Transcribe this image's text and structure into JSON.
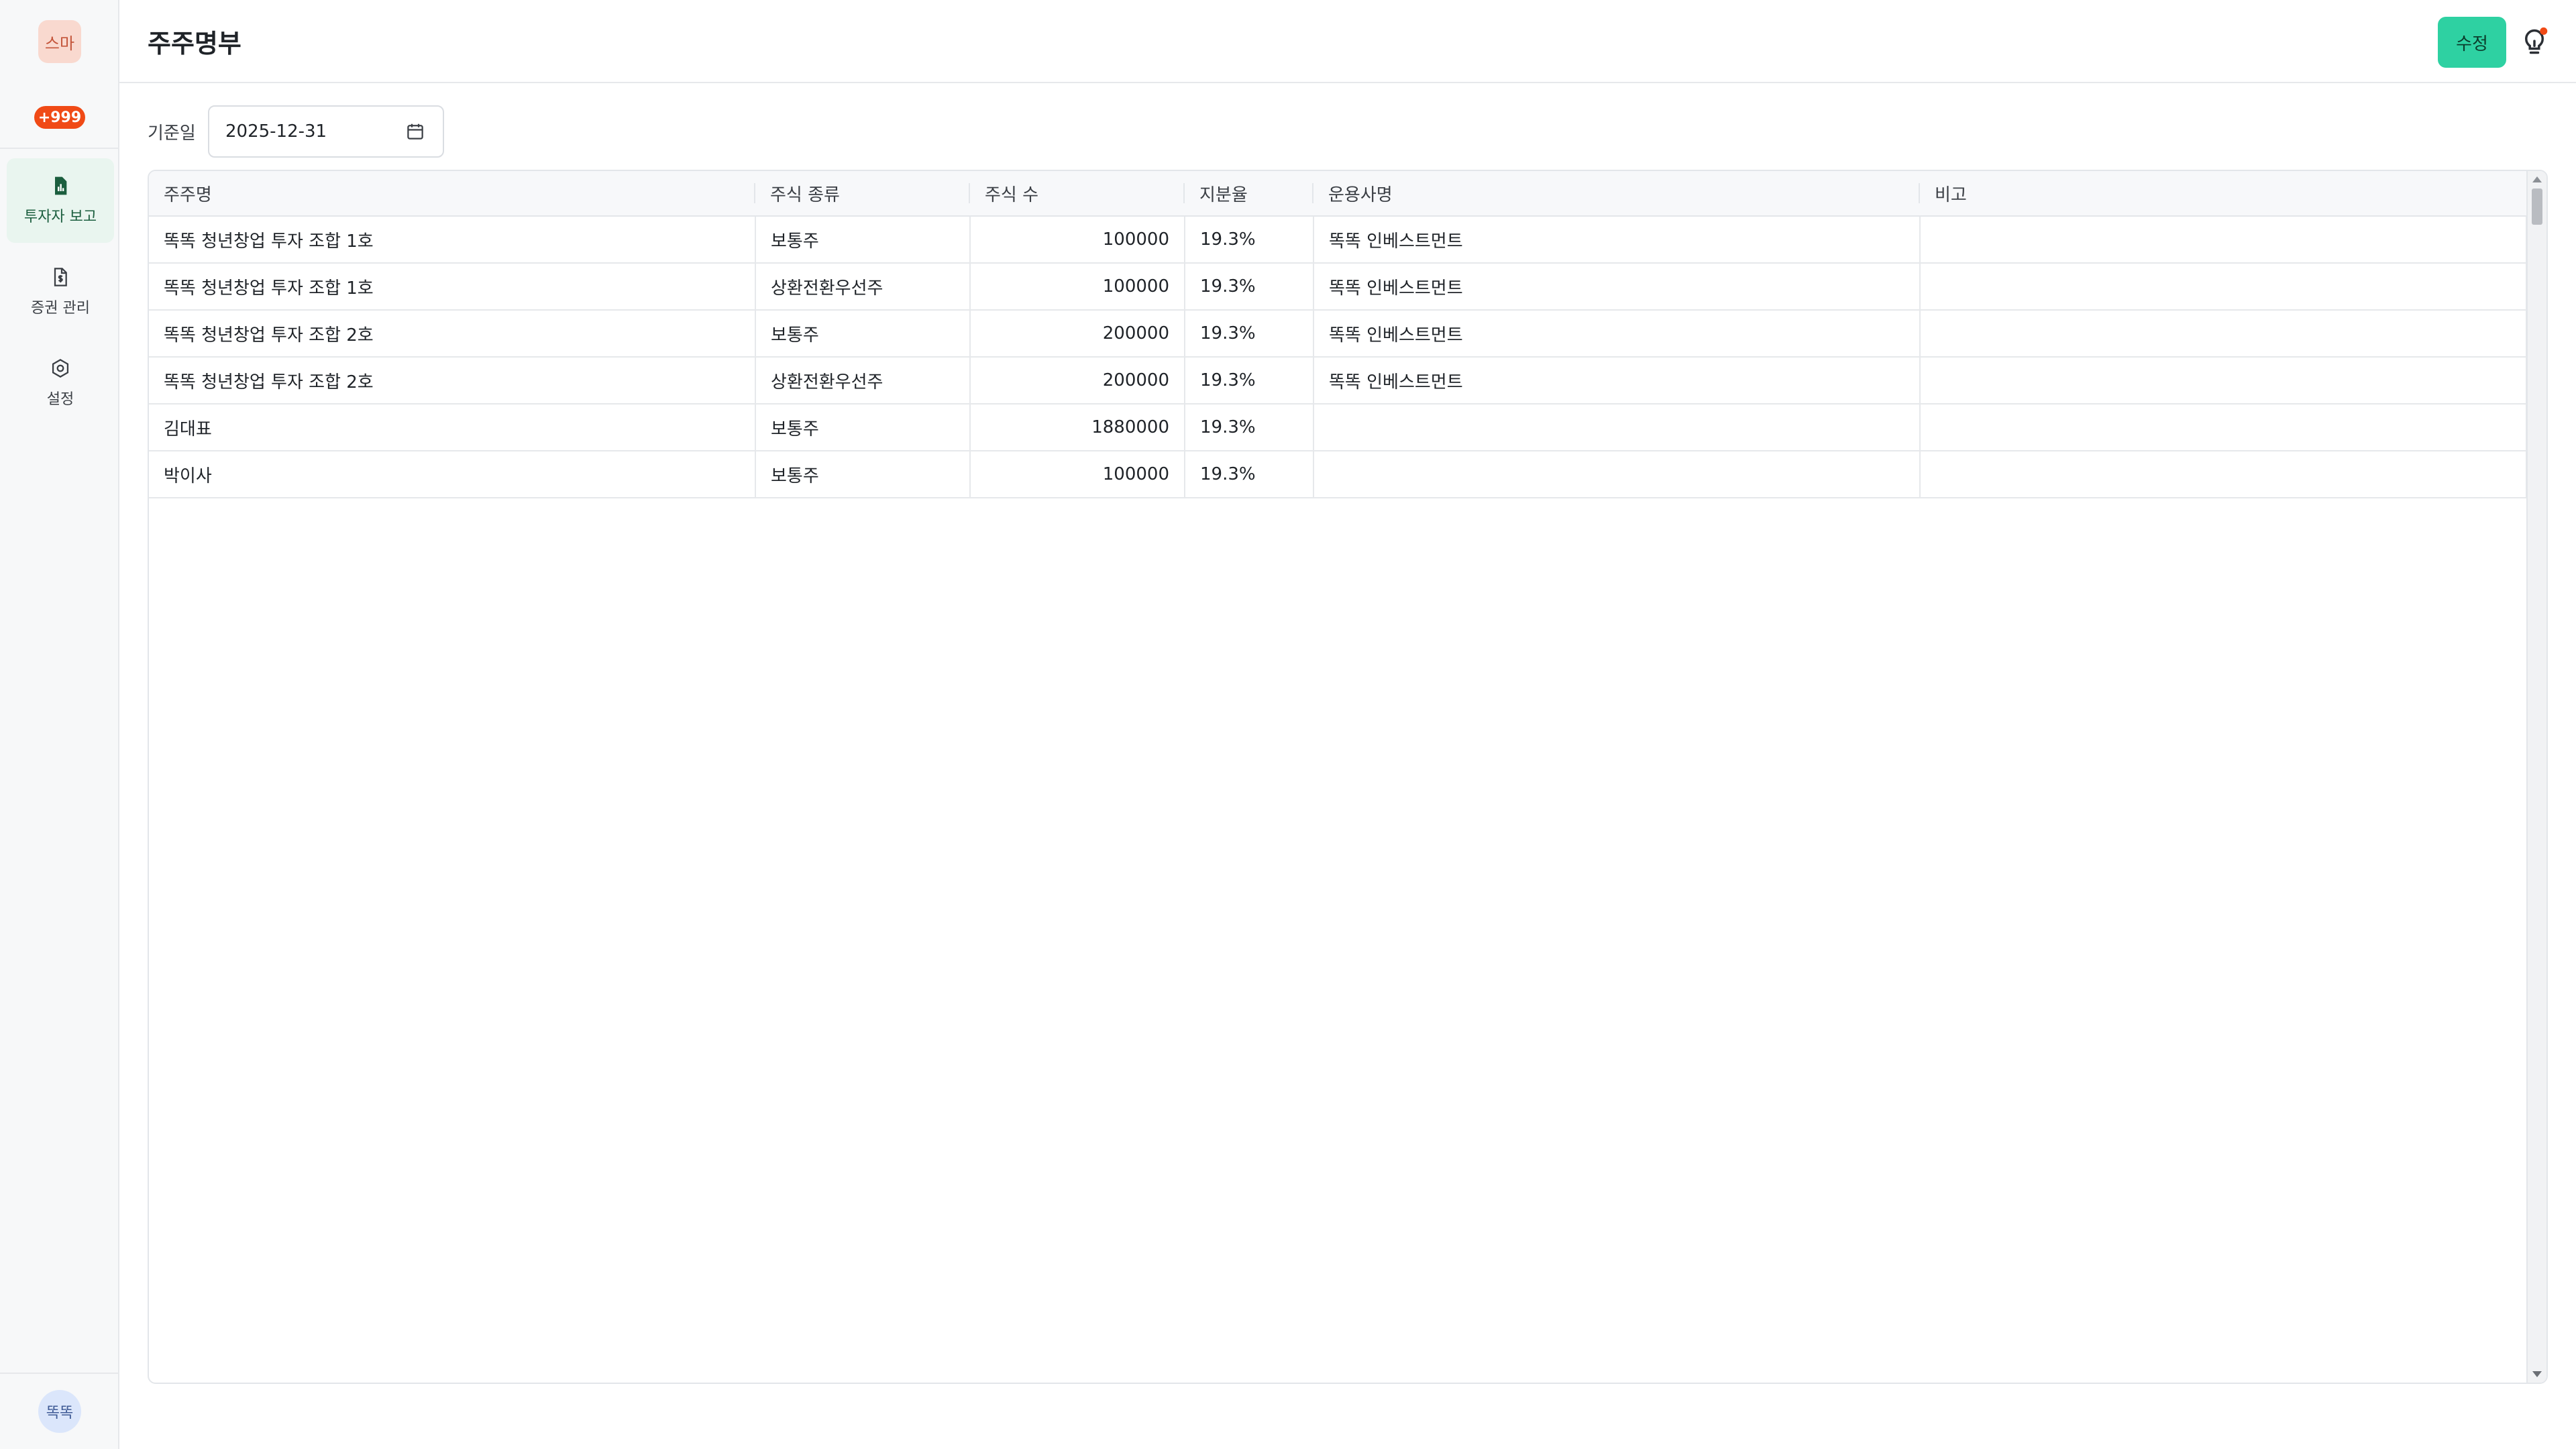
{
  "sidebar": {
    "org_avatar": "스마",
    "notification_badge": "+999",
    "items": [
      {
        "label": "투자자 보고",
        "icon": "report-chart-icon",
        "active": true
      },
      {
        "label": "증권 관리",
        "icon": "document-dollar-icon",
        "active": false
      },
      {
        "label": "설정",
        "icon": "gear-icon",
        "active": false
      }
    ],
    "user_avatar": "똑똑"
  },
  "header": {
    "title": "주주명부",
    "edit_label": "수정",
    "help_icon": "lightbulb-icon"
  },
  "filter": {
    "date_label": "기준일",
    "date_value": "2025-12-31",
    "calendar_icon": "calendar-icon"
  },
  "table": {
    "columns": [
      "주주명",
      "주식 종류",
      "주식 수",
      "지분율",
      "운용사명",
      "비고"
    ],
    "rows": [
      {
        "name": "똑똑 청년창업 투자 조합 1호",
        "share_type": "보통주",
        "shares": "100000",
        "ratio": "19.3%",
        "manager": "똑똑 인베스트먼트",
        "note": ""
      },
      {
        "name": "똑똑 청년창업 투자 조합 1호",
        "share_type": "상환전환우선주",
        "shares": "100000",
        "ratio": "19.3%",
        "manager": "똑똑 인베스트먼트",
        "note": ""
      },
      {
        "name": "똑똑 청년창업 투자 조합 2호",
        "share_type": "보통주",
        "shares": "200000",
        "ratio": "19.3%",
        "manager": "똑똑 인베스트먼트",
        "note": ""
      },
      {
        "name": "똑똑 청년창업 투자 조합 2호",
        "share_type": "상환전환우선주",
        "shares": "200000",
        "ratio": "19.3%",
        "manager": "똑똑 인베스트먼트",
        "note": ""
      },
      {
        "name": "김대표",
        "share_type": "보통주",
        "shares": "1880000",
        "ratio": "19.3%",
        "manager": "",
        "note": ""
      },
      {
        "name": "박이사",
        "share_type": "보통주",
        "shares": "100000",
        "ratio": "19.3%",
        "manager": "",
        "note": ""
      }
    ]
  },
  "colors": {
    "accent": "#2ed1a2",
    "badge": "#f04a16",
    "active_nav_bg": "#e9f5ef"
  }
}
